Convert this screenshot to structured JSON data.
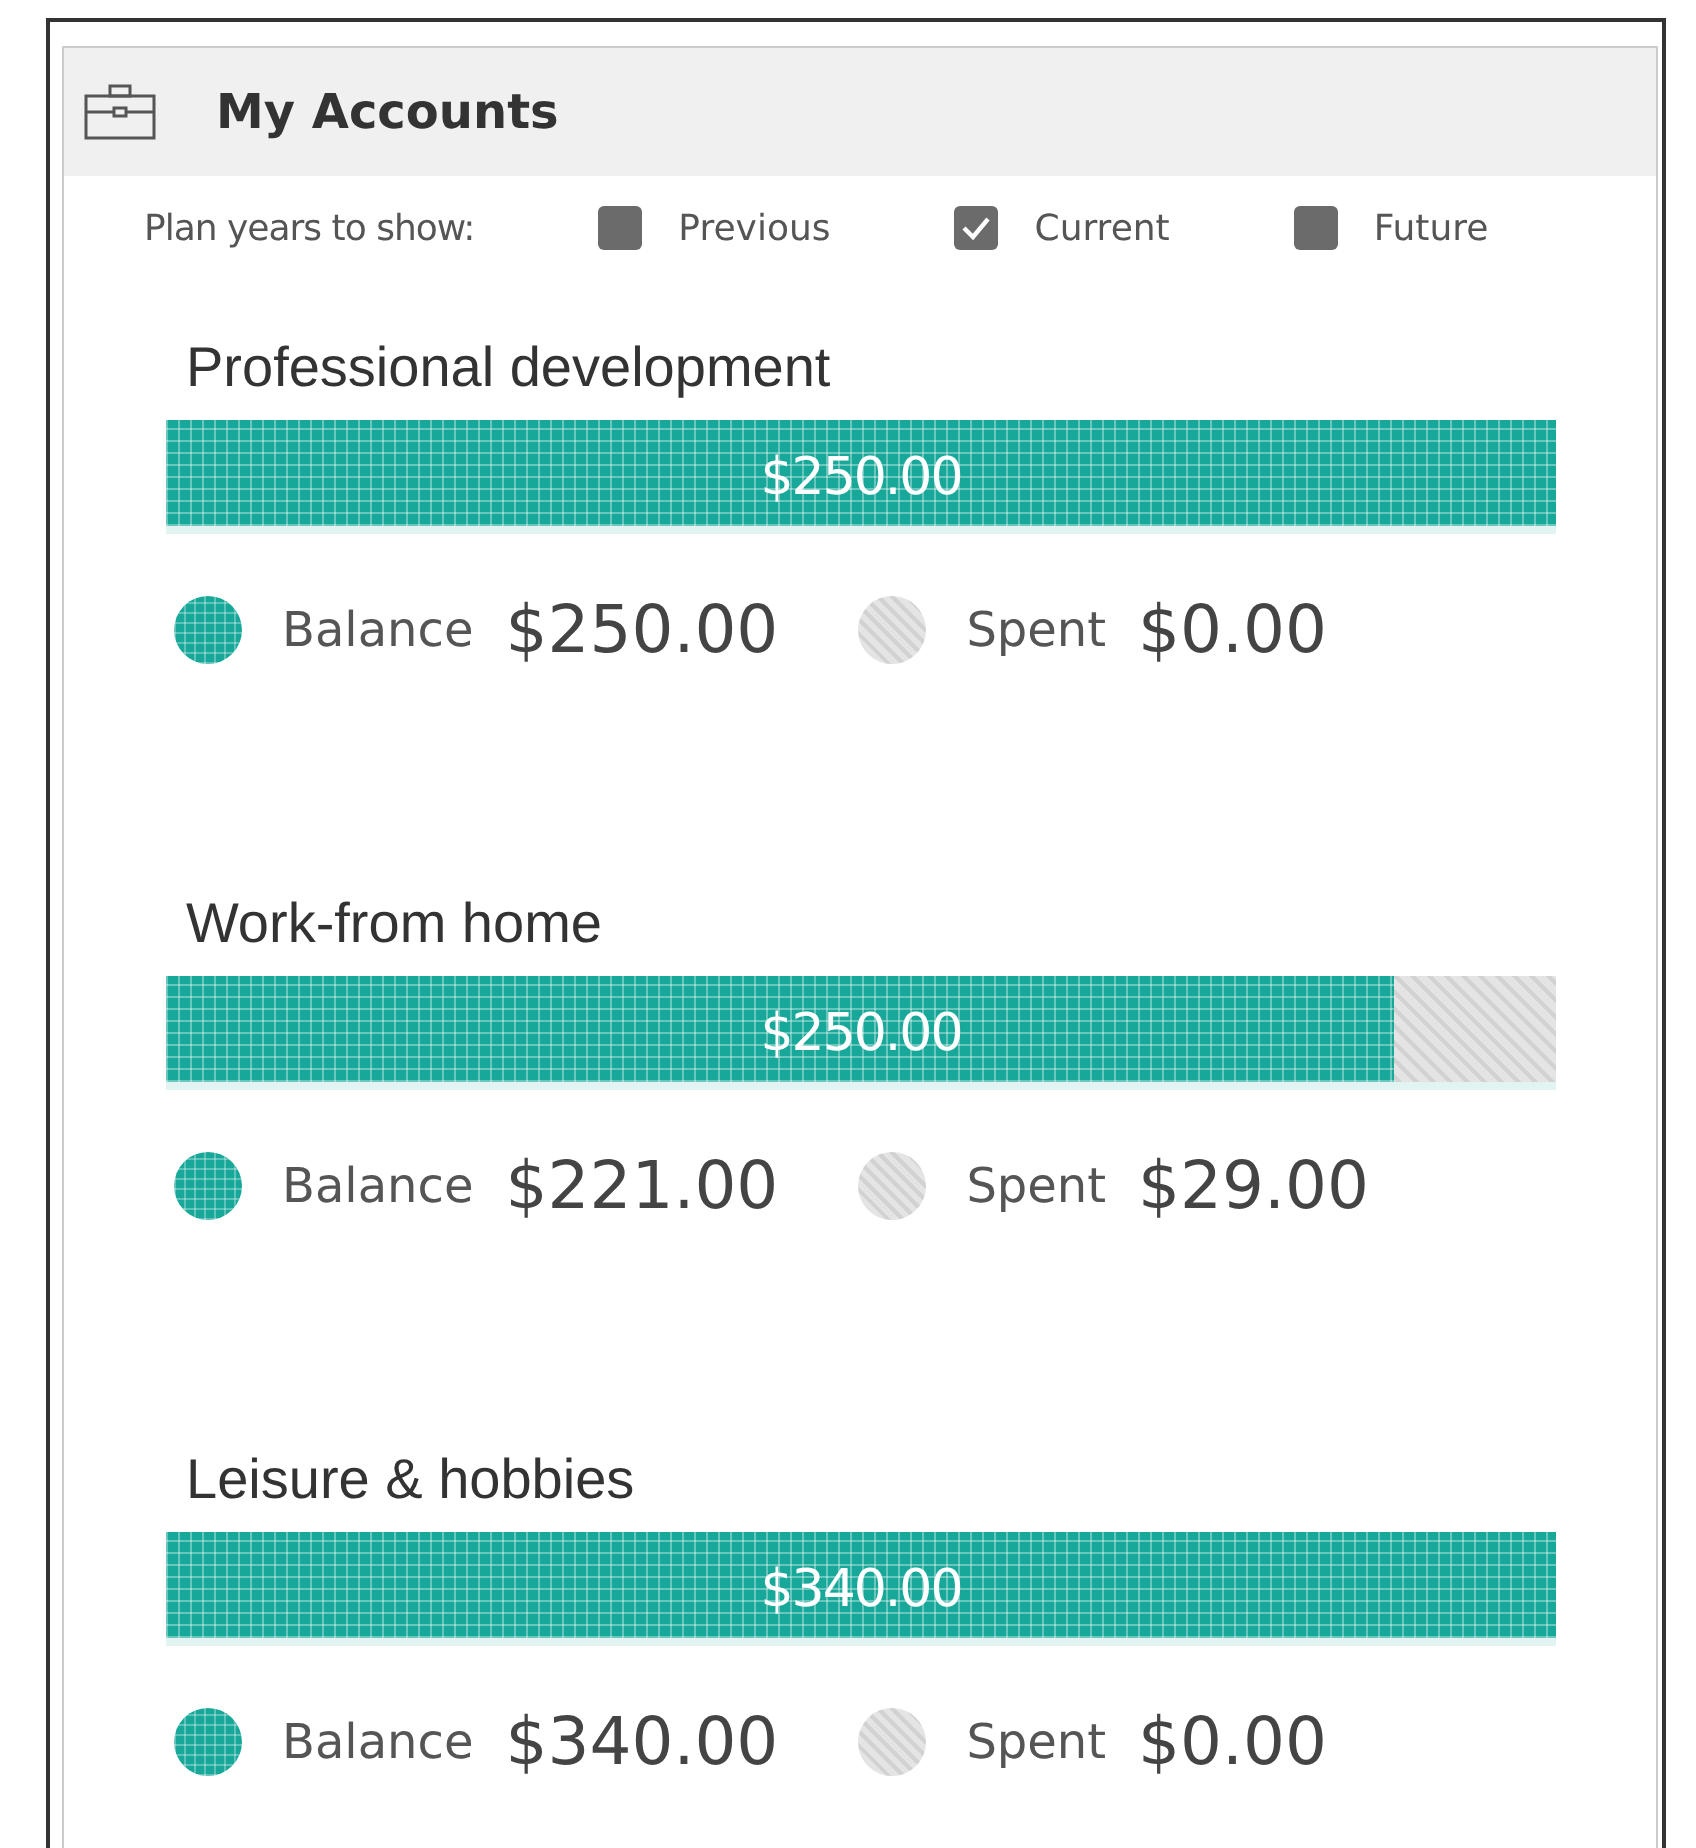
{
  "panel": {
    "title": "My Accounts"
  },
  "filters": {
    "label": "Plan years to show:",
    "options": [
      {
        "label": "Previous",
        "checked": false
      },
      {
        "label": "Current",
        "checked": true
      },
      {
        "label": "Future",
        "checked": false
      }
    ]
  },
  "accounts": [
    {
      "name": "Professional development",
      "total": "$250.00",
      "level": 1,
      "balance_label": "Balance",
      "balance": "$250.00",
      "spent_label": "Spent",
      "spent": "$0.00"
    },
    {
      "name": "Work-from home",
      "total": "$250.00",
      "level": 0.884,
      "balance_label": "Balance",
      "balance": "$221.00",
      "spent_label": "Spent",
      "spent": "$29.00"
    },
    {
      "name": "Leisure & hobbies",
      "total": "$340.00",
      "level": 1,
      "balance_label": "Balance",
      "balance": "$340.00",
      "spent_label": "Spent",
      "spent": "$0.00"
    }
  ]
}
